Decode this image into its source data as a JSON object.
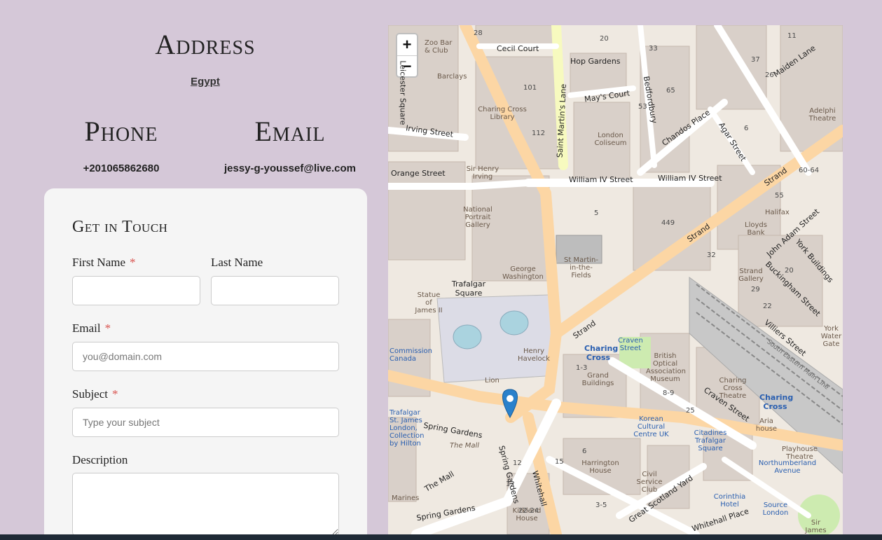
{
  "address": {
    "title": "Address",
    "value": "Egypt"
  },
  "phone": {
    "title": "Phone",
    "value": "+201065862680"
  },
  "email": {
    "title": "Email",
    "value": "jessy-g-youssef@live.com"
  },
  "form": {
    "title": "Get in Touch",
    "first_name_label": "First Name",
    "last_name_label": "Last Name",
    "email_label": "Email",
    "email_placeholder": "you@domain.com",
    "subject_label": "Subject",
    "subject_placeholder": "Type your subject",
    "description_label": "Description",
    "required_mark": "*"
  },
  "map": {
    "zoom_in": "+",
    "zoom_out": "−",
    "streets": {
      "cecil_court": "Cecil Court",
      "hop_gardens": "Hop Gardens",
      "mays_court": "May's Court",
      "irving_street": "Irving Street",
      "orange_street": "Orange Street",
      "william_iv_street": "William IV Street",
      "william_iv_street_2": "William IV Street",
      "saint_martins_lane": "Saint Martin's Lane",
      "bedfordbury": "Bedfordbury",
      "chandos_place": "Chandos Place",
      "agar_street": "Agar Street",
      "strand": "Strand",
      "strand_2": "Strand",
      "strand_3": "Strand",
      "john_adam_street": "John Adam Street",
      "york_buildings": "York Buildings",
      "buckingham_street": "Buckingham Street",
      "villiers_street": "Villiers Street",
      "craven_street": "Craven Street",
      "spring_gardens": "Spring Gardens",
      "spring_gardens_2": "Spring Gardens",
      "the_mall": "The Mall",
      "whitehall": "Whitehall",
      "great_scotland_yard": "Great Scotland Yard",
      "whitehall_place": "Whitehall Place",
      "northumberland_avenue": "Northumberland Avenue",
      "maiden_lane": "Maiden Lane",
      "leicester_square": "Leicester Square"
    },
    "places": {
      "zoo_bar": "Zoo Bar & Club",
      "barclays": "Barclays",
      "charing_cross_library": "Charing Cross Library",
      "london_coliseum": "London Coliseum",
      "sir_henry_irving": "Sir Henry Irving",
      "national_portrait_gallery": "National Portrait Gallery",
      "st_martin": "St Martin-in-the-Fields",
      "george_washington": "George Washington",
      "trafalgar_square": "Trafalgar Square",
      "statue_james": "Statue of James II",
      "henry_havelock": "Henry Havelock",
      "lion": "Lion",
      "commission_canada": "Commission Canada",
      "trafalgar_st_james": "Trafalgar St. James London, Collection by Hilton",
      "charing_cross": "Charing Cross",
      "charing_cross_2": "Charing Cross",
      "craven_street_pub": "Craven Street",
      "grand_buildings": "Grand Buildings",
      "british_optical": "British Optical Association Museum",
      "charing_cross_theatre": "Charing Cross Theatre",
      "lloyds_bank": "Lloyds Bank",
      "halifax": "Halifax",
      "strand_gallery": "Strand Gallery",
      "adelphi_theatre": "Adelphi Theatre",
      "korean_cultural": "Korean Cultural Centre UK",
      "citadines": "Citadines Trafalgar Square",
      "harrington_house": "Harrington House",
      "civil_service_club": "Civil Service Club",
      "kirkland_house": "Kirkland House",
      "aria_house": "Aria house",
      "playhouse_theatre": "Playhouse Theatre",
      "corinthia_hotel": "Corinthia Hotel",
      "source_london": "Source London",
      "sir_james_outram": "Sir James Outram",
      "york_water_gate": "York Water Gate",
      "marines": "Marines",
      "the_mall_2": "The Mall",
      "south_eastern": "South Eastern Main Line"
    },
    "numbers": [
      "28",
      "20",
      "11",
      "33",
      "37",
      "26",
      "101",
      "112",
      "65",
      "53",
      "6",
      "449",
      "32",
      "55",
      "29",
      "22",
      "20",
      "12",
      "15",
      "6",
      "12",
      "22-24",
      "3-5",
      "8-9",
      "25",
      "1-3",
      "5",
      "60-64"
    ]
  }
}
